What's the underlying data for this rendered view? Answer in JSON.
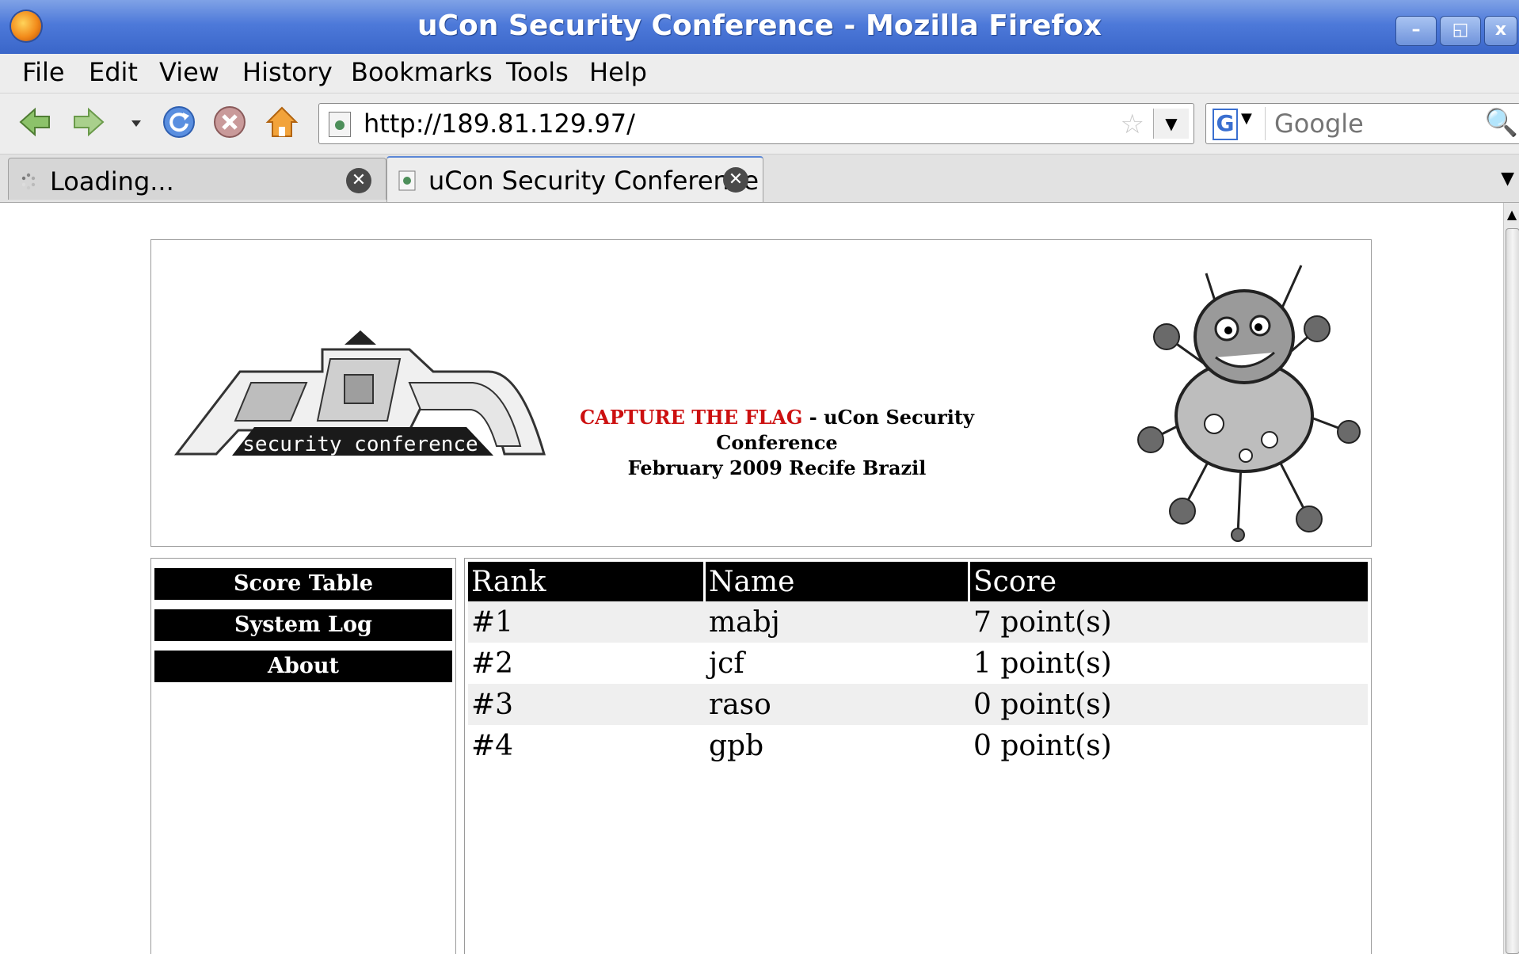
{
  "window": {
    "title": "uCon Security Conference - Mozilla Firefox",
    "buttons": [
      "–",
      "◱",
      "x"
    ]
  },
  "menu": [
    "File",
    "Edit",
    "View",
    "History",
    "Bookmarks",
    "Tools",
    "Help"
  ],
  "toolbar": {
    "url": "http://189.81.129.97/",
    "search_placeholder": "Google",
    "search_engine": "G"
  },
  "tabs": [
    {
      "label": "Loading...",
      "active": false
    },
    {
      "label": "uCon Security Conference",
      "active": true
    }
  ],
  "banner": {
    "logo_text": "security conference",
    "caption_highlight": "CAPTURE THE FLAG",
    "caption_rest": " - uCon Security Conference",
    "caption_line2": "February 2009 Recife Brazil",
    "highlight_color": "#cc1010"
  },
  "nav": [
    {
      "label": "Score Table"
    },
    {
      "label": "System Log"
    },
    {
      "label": "About"
    }
  ],
  "scoretable": {
    "headers": [
      "Rank",
      "Name",
      "Score"
    ],
    "rows": [
      {
        "rank": "#1",
        "name": "mabj",
        "score": "7 point(s)"
      },
      {
        "rank": "#2",
        "name": "jcf",
        "score": "1 point(s)"
      },
      {
        "rank": "#3",
        "name": "raso",
        "score": "0 point(s)"
      },
      {
        "rank": "#4",
        "name": "gpb",
        "score": "0 point(s)"
      }
    ]
  }
}
